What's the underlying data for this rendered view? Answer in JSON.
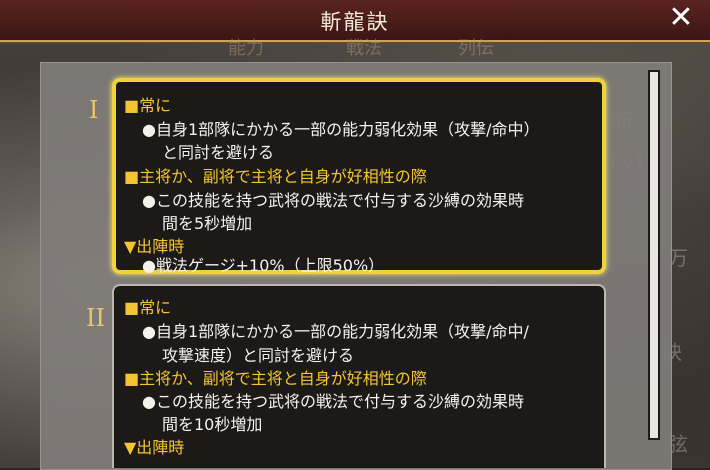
{
  "window": {
    "title": "斬龍訣"
  },
  "background_tabs": [
    "能力",
    "戦法",
    "列伝"
  ],
  "levels": [
    {
      "numeral": "I",
      "lines": [
        "■常に",
        "●自身1部隊にかかる一部の能力弱化効果（攻撃/命中）",
        "と同討を避ける",
        "■主将か、副将で主将と自身が好相性の際",
        "●この技能を持つ武将の戦法で付与する沙縛の効果時",
        "間を5秒増加",
        "▼出陣時",
        "●戦法ゲージ+10%（上限50%）"
      ]
    },
    {
      "numeral": "II",
      "lines": [
        "■常に",
        "●自身1部隊にかかる一部の能力弱化効果（攻撃/命中/",
        "攻撃速度）と同討を避ける",
        "■主将か、副将で主将と自身が好相性の際",
        "●この技能を持つ武将の戦法で付与する沙縛の効果時",
        "間を10秒増加",
        "▼出陣時"
      ]
    }
  ],
  "colors": {
    "selected_border": "#f0d33a",
    "header_text": "#f4c531",
    "body_text": "#f5f2ec",
    "titlebar": "#4a1c1a"
  },
  "icons": {
    "close": "close-icon"
  }
}
